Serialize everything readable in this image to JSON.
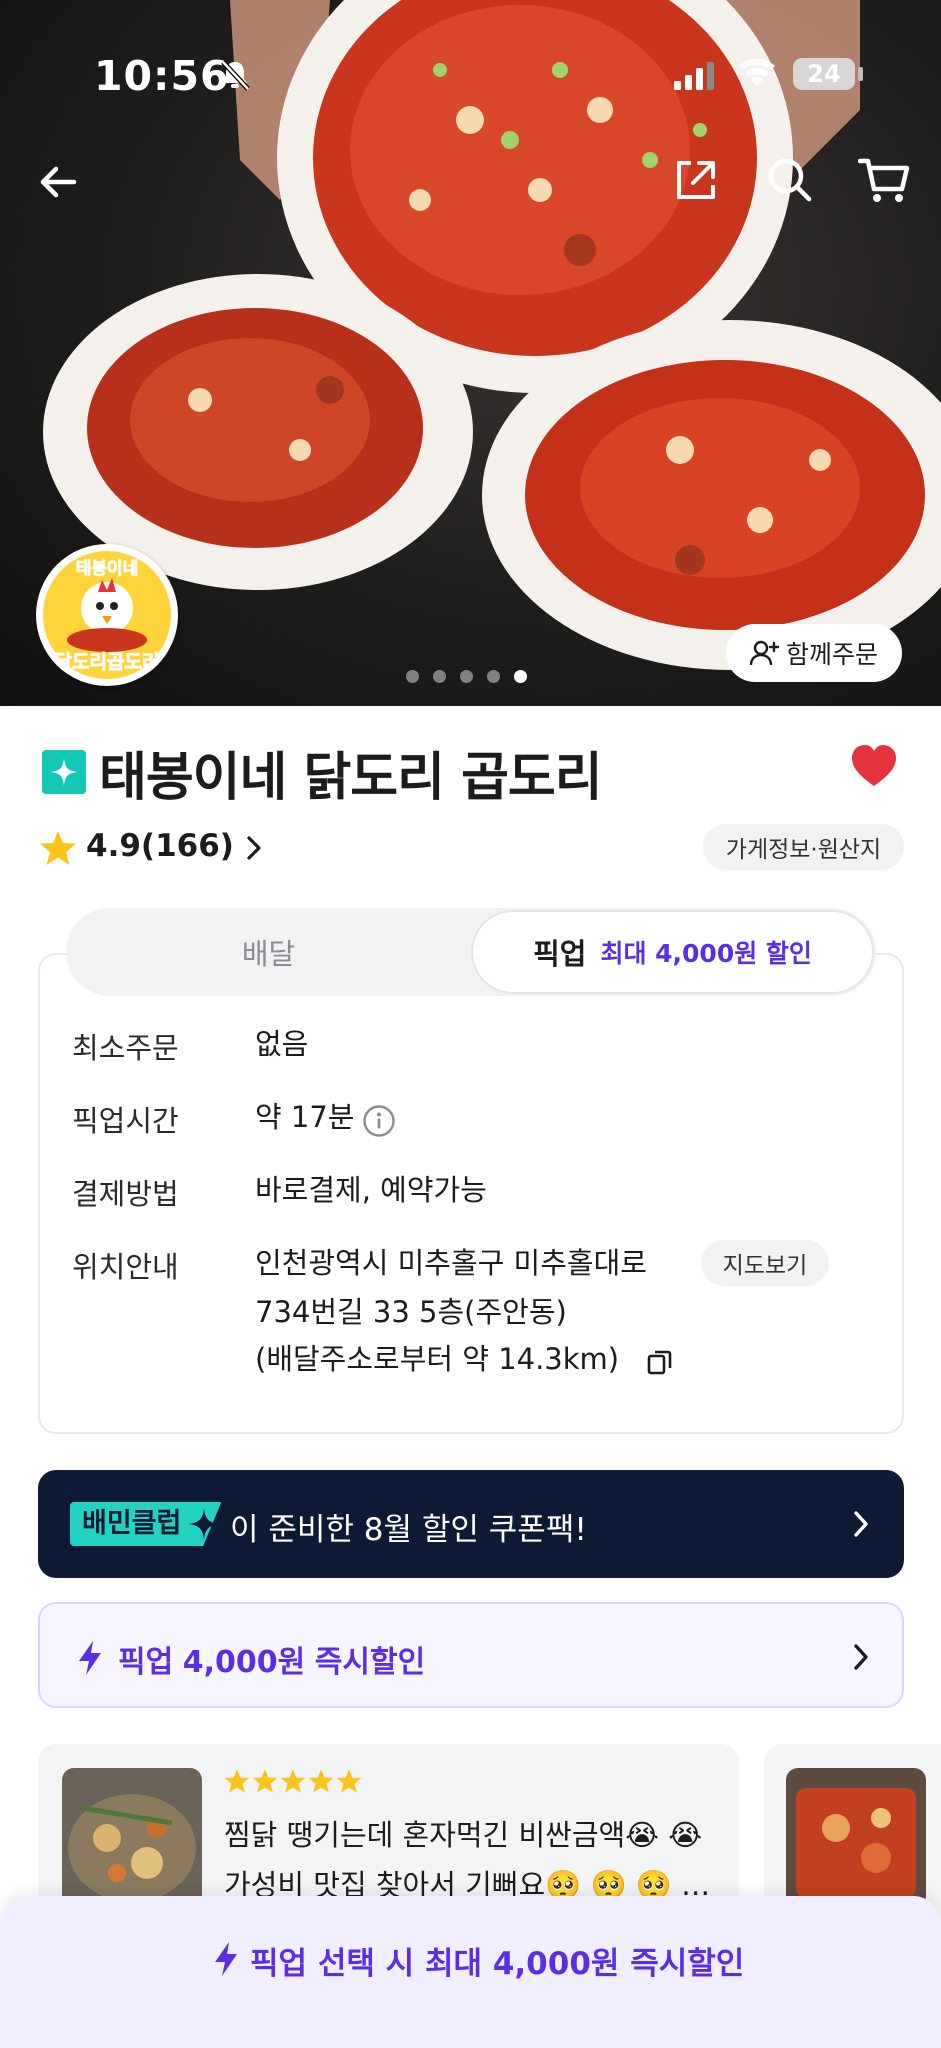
{
  "status_bar": {
    "time": "10:56",
    "battery": "24"
  },
  "hero": {
    "logo_top_text": "태봉이네",
    "logo_bottom_text": "닭도리곱도리",
    "together_order": "함께주문",
    "carousel_total": 5,
    "carousel_active_index": 5
  },
  "store": {
    "name": "태봉이네 닭도리 곱도리",
    "rating": "4.9(166)",
    "info_button": "가게정보·원산지",
    "favorited": true
  },
  "tabs": {
    "delivery": "배달",
    "pickup": "픽업",
    "pickup_discount": "최대 4,000원 할인",
    "selected": "pickup"
  },
  "details": {
    "rows": [
      {
        "label": "최소주문",
        "value": "없음"
      },
      {
        "label": "픽업시간",
        "value": "약 17분"
      },
      {
        "label": "결제방법",
        "value": "바로결제, 예약가능"
      },
      {
        "label": "위치안내",
        "value_lines": [
          "인천광역시 미추홀구 미추홀대로",
          "734번길 33 5층(주안동)",
          "(배달주소로부터 약 14.3km)"
        ]
      }
    ],
    "map_button": "지도보기"
  },
  "club_banner": {
    "tag": "배민클럽",
    "text": "이 준비한 8월 할인 쿠폰팩!"
  },
  "pickup_banner": {
    "prefix": "픽업",
    "amount": "4,000원",
    "suffix": "즉시할인"
  },
  "review": {
    "stars": 5,
    "line1": "찜닭 땡기는데 혼자먹긴 비싼금액😭 😭",
    "line2": "가성비 맛집 찾아서 기뻐요🥺 🥺 🥺 …"
  },
  "bottom_bar": {
    "prefix": "픽업 선택 시 최대",
    "amount": "4,000원",
    "suffix": "즉시할인"
  },
  "colors": {
    "accent_purple": "#5B2EE6",
    "mint": "#22D3C1",
    "navy": "#0C1A35",
    "heart_red": "#E5323C"
  }
}
